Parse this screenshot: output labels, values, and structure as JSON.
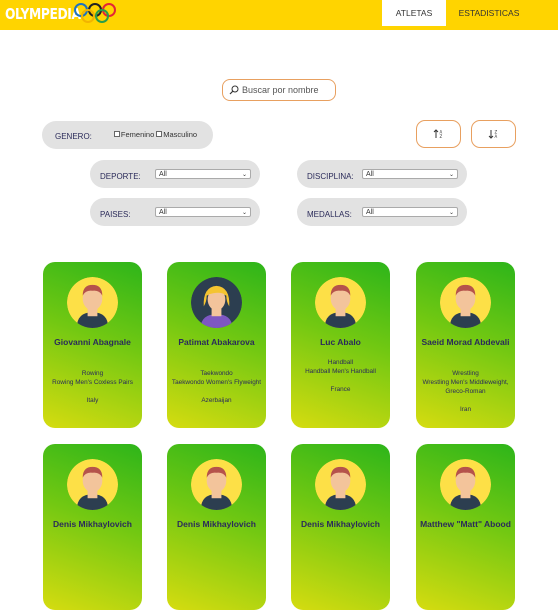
{
  "header": {
    "logo_text": "OLYMPEDIA",
    "tabs": [
      {
        "label": "ATLETAS",
        "active": true
      },
      {
        "label": "ESTADISTICAS",
        "active": false
      }
    ],
    "bg_color": "#ffd400"
  },
  "search": {
    "placeholder": "Buscar por nombre",
    "value": ""
  },
  "filters": {
    "genero": {
      "label": "GENERO:",
      "options": [
        "Femenino",
        "Masculino"
      ]
    },
    "deporte": {
      "label": "DEPORTE:",
      "value": "All"
    },
    "disciplina": {
      "label": "DISCIPLINA:",
      "value": "All"
    },
    "paises": {
      "label": "PAISES:",
      "value": "All"
    },
    "medallas": {
      "label": "MEDALLAS:",
      "value": "All"
    }
  },
  "sort_buttons": {
    "asc_icon": "sort-ascending-icon",
    "desc_icon": "sort-descending-icon",
    "accent": "#e8a060"
  },
  "athletes": [
    {
      "name": "Giovanni Abagnale",
      "sport": "Rowing",
      "event": "Rowing Men's Coxless Pairs",
      "country": "Italy",
      "gender": "male"
    },
    {
      "name": "Patimat Abakarova",
      "sport": "Taekwondo",
      "event": "Taekwondo Women's Flyweight",
      "country": "Azerbaijan",
      "gender": "female"
    },
    {
      "name": "Luc Abalo",
      "sport": "Handball",
      "event": "Handball Men's Handball",
      "country": "France",
      "gender": "male"
    },
    {
      "name": "Saeid Morad Abdevali",
      "sport": "Wrestling",
      "event": "Wrestling Men's Middleweight, Greco-Roman",
      "country": "Iran",
      "gender": "male"
    },
    {
      "name": "Denis Mikhaylovich",
      "sport": "",
      "event": "",
      "country": "",
      "gender": "male"
    },
    {
      "name": "Denis Mikhaylovich",
      "sport": "",
      "event": "",
      "country": "",
      "gender": "male"
    },
    {
      "name": "Denis Mikhaylovich",
      "sport": "",
      "event": "",
      "country": "",
      "gender": "male"
    },
    {
      "name": "Matthew \"Matt\" Abood",
      "sport": "",
      "event": "",
      "country": "",
      "gender": "male"
    }
  ]
}
